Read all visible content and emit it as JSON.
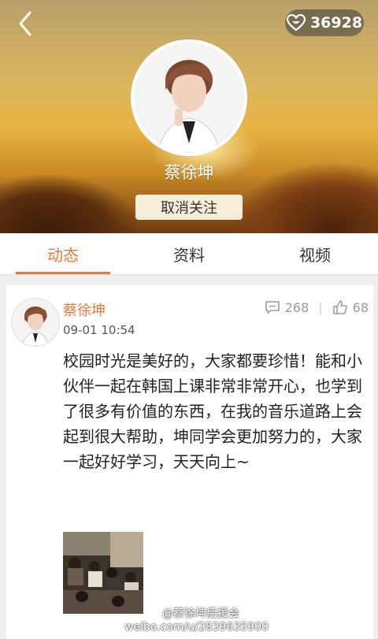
{
  "header": {
    "likes_count": "36928",
    "name": "蔡徐坤",
    "unfollow_label": "取消关注"
  },
  "tabs": [
    {
      "label": "动态",
      "active": true
    },
    {
      "label": "资料",
      "active": false
    },
    {
      "label": "视频",
      "active": false
    }
  ],
  "post": {
    "author": "蔡徐坤",
    "time": "09-01 10:54",
    "comments": "268",
    "likes": "68",
    "text": "校园时光是美好的，大家都要珍惜！能和小伙伴一起在韩国上课非常非常开心，也学到了很多有价值的东西，在我的音乐道路上会起到很大帮助，坤同学会更加努力的，大家一起好好学习，天天向上~"
  },
  "watermark": {
    "line1": "@蔡徐坤后援会",
    "line2": "weibo.com/u/2839635900"
  },
  "colors": {
    "accent": "#e8773a",
    "stat_gray": "#9a9a9a"
  }
}
